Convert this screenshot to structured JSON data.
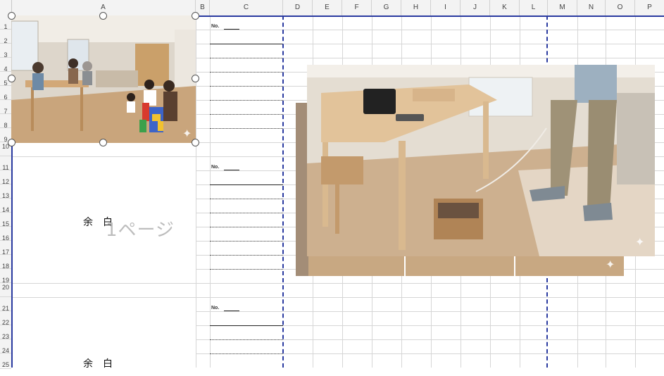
{
  "columns": [
    "A",
    "B",
    "C",
    "D",
    "E",
    "F",
    "G",
    "H",
    "I",
    "J",
    "K",
    "L",
    "M",
    "N",
    "O",
    "P"
  ],
  "rows": [
    "1",
    "2",
    "3",
    "4",
    "5",
    "6",
    "7",
    "8",
    "9",
    "10",
    "11",
    "12",
    "13",
    "14",
    "15",
    "16",
    "17",
    "18",
    "19",
    "20",
    "21",
    "22",
    "23",
    "24",
    "25"
  ],
  "form": {
    "no_label": "No.",
    "margin_text": "余　白",
    "page_watermark": "1ページ"
  },
  "images": {
    "main_photo": "family-living-room-photo",
    "overlay_photo": "dining-table-photo",
    "sparkle": "✦"
  },
  "colors": {
    "page_break": "#2a3aa0",
    "grid": "#d6d6d6",
    "header_bg": "#f3f3f3"
  }
}
